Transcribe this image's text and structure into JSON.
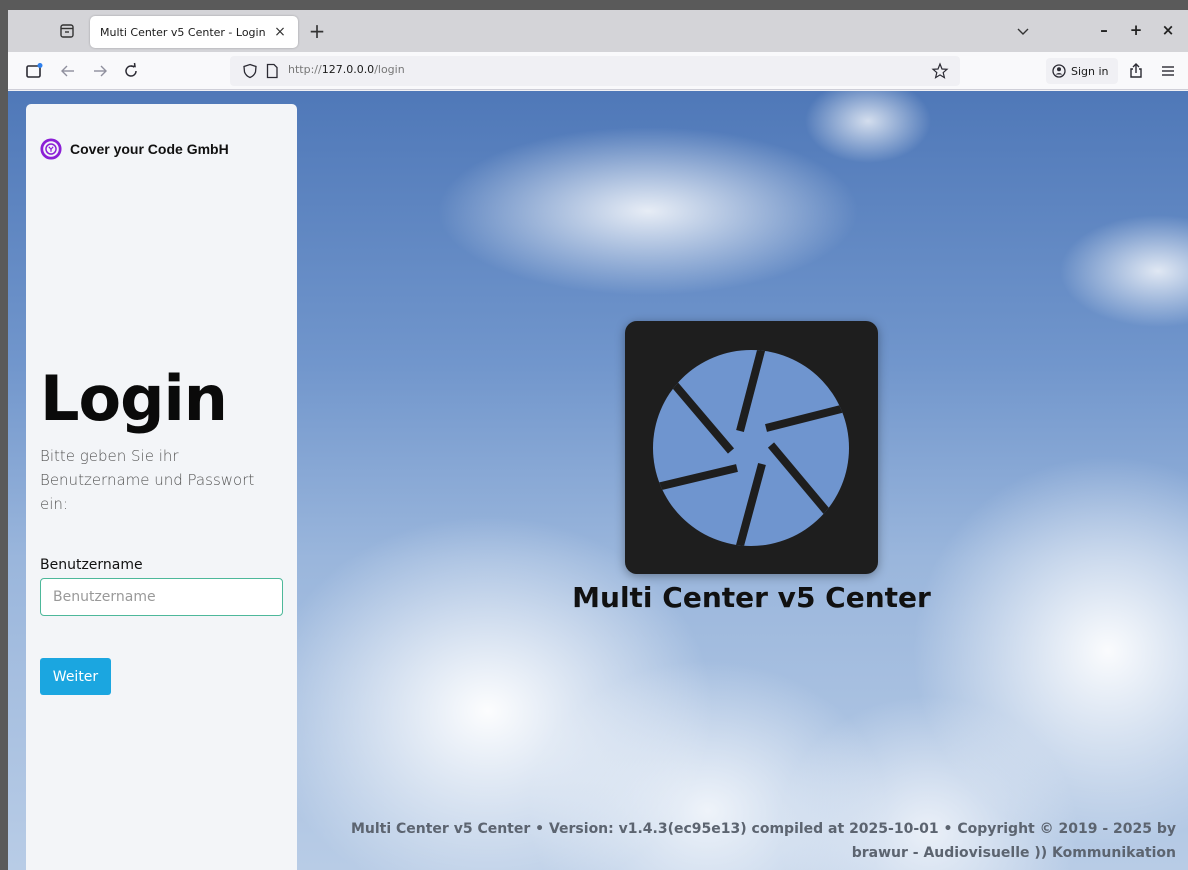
{
  "browser": {
    "tab_title": "Multi Center v5 Center - Login",
    "tab_close": "×",
    "new_tab": "+",
    "url_scheme": "http://",
    "url_host": "127.0.0.0",
    "url_path": "/login",
    "sign_in_label": "Sign in",
    "window_controls": {
      "minimize": "–",
      "maximize": "+",
      "close": "×"
    }
  },
  "sidebar": {
    "brand_name": "Cover your Code GmbH",
    "brand_color": "#8b1fd6",
    "title": "Login",
    "description": "Bitte geben Sie ihr Benutzername und Passwort ein:",
    "username_label": "Benutzername",
    "username_placeholder": "Benutzername",
    "username_value": "",
    "submit_label": "Weiter",
    "submit_color": "#1ba6e0"
  },
  "main": {
    "app_title": "Multi Center v5 Center",
    "footer": "Multi Center v5 Center • Version: v1.4.3(ec95e13) compiled at 2025-10-01 • Copyright © 2019 - 2025 by brawur - Audiovisuelle )) Kommunikation"
  }
}
